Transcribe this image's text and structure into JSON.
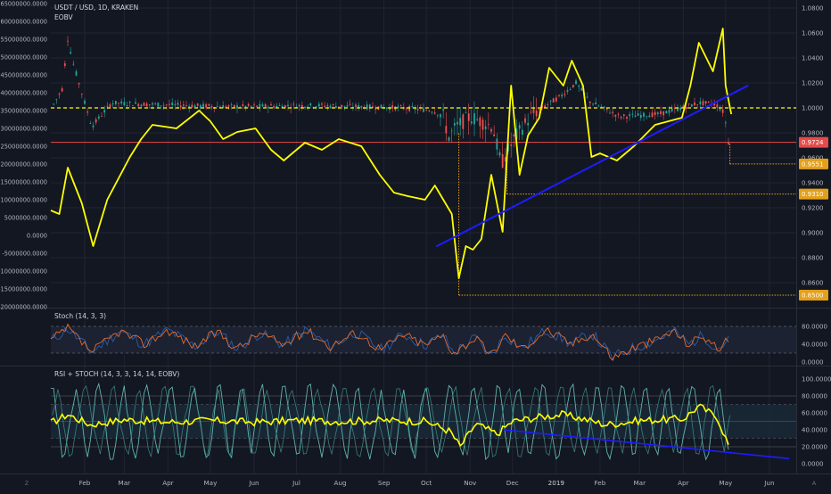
{
  "colors": {
    "background": "#131722",
    "grid": "#1f2433",
    "text": "#b2b5be",
    "eobv_line": "#ffff00",
    "trendline": "#1d1dff",
    "level_line": "#e5a019",
    "current_price_line": "#e64a4a",
    "candle_up": "#26a69a",
    "candle_down": "#ef5350",
    "stoch_k": "#2b5cad",
    "stoch_d": "#e36b2c",
    "rsi_teal": "#5fb3ad"
  },
  "header": {
    "symbol": "USDT / USD, 1D, KRAKEN",
    "indicator": "EOBV"
  },
  "pane_labels": {
    "stoch": "Stoch (14, 3, 3)",
    "rsi_stoch": "RSI + STOCH (14, 3, 3, 14, 14, EOBV)"
  },
  "left_axis_ticks": [
    "65000000.0000",
    "60000000.0000",
    "55000000.0000",
    "50000000.0000",
    "45000000.0000",
    "40000000.0000",
    "35000000.0000",
    "30000000.0000",
    "25000000.0000",
    "20000000.0000",
    "15000000.0000",
    "10000000.0000",
    "5000000.0000",
    "0.0000",
    "-5000000.0000",
    "-10000000.0000",
    "-15000000.0000",
    "-20000000.0000"
  ],
  "right_axis_ticks": [
    "1.0800",
    "1.0600",
    "1.0400",
    "1.0200",
    "1.0000",
    "0.9800",
    "0.9600",
    "0.9400",
    "0.9200",
    "0.9000",
    "0.8800",
    "0.8600"
  ],
  "price_tags": [
    {
      "label": "0.9724",
      "value": 0.9724,
      "type": "current"
    },
    {
      "label": "0.9551",
      "value": 0.9551,
      "type": "level"
    },
    {
      "label": "0.9310",
      "value": 0.931,
      "type": "level"
    },
    {
      "label": "0.8500",
      "value": 0.85,
      "type": "level"
    }
  ],
  "stoch_ticks": [
    "80.0000",
    "40.0000",
    "0.0000"
  ],
  "rsi_ticks": [
    "100.0000",
    "80.0000",
    "60.0000",
    "40.0000",
    "20.0000",
    "0.0000"
  ],
  "time_axis": [
    "Feb",
    "Mar",
    "Apr",
    "May",
    "Jun",
    "Jul",
    "Aug",
    "Sep",
    "Oct",
    "Nov",
    "Dec",
    "2019",
    "Feb",
    "Mar",
    "Apr",
    "May",
    "Jun"
  ],
  "corner_labels": {
    "left": "Z",
    "right": "A"
  },
  "chart_data": {
    "type": "line",
    "title": "USDT / USD, 1D, KRAKEN",
    "x_range": [
      "2018-01-08",
      "2019-06-20"
    ],
    "price_axis_range": [
      0.84,
      1.085
    ],
    "eobv_axis_range": [
      -20000000,
      65000000
    ],
    "series": [
      {
        "name": "EOBV",
        "axis": "left",
        "points": [
          [
            "2018-01-08",
            7000000
          ],
          [
            "2018-01-14",
            6000000
          ],
          [
            "2018-01-20",
            19000000
          ],
          [
            "2018-01-30",
            9000000
          ],
          [
            "2018-02-07",
            -3000000
          ],
          [
            "2018-02-17",
            10000000
          ],
          [
            "2018-03-05",
            22000000
          ],
          [
            "2018-03-13",
            27000000
          ],
          [
            "2018-03-21",
            31000000
          ],
          [
            "2018-04-07",
            30000000
          ],
          [
            "2018-04-23",
            35000000
          ],
          [
            "2018-05-01",
            32000000
          ],
          [
            "2018-05-10",
            27000000
          ],
          [
            "2018-05-20",
            29000000
          ],
          [
            "2018-06-02",
            30000000
          ],
          [
            "2018-06-13",
            24000000
          ],
          [
            "2018-06-22",
            21000000
          ],
          [
            "2018-07-07",
            26000000
          ],
          [
            "2018-07-19",
            24000000
          ],
          [
            "2018-07-31",
            27000000
          ],
          [
            "2018-08-16",
            25000000
          ],
          [
            "2018-08-29",
            17000000
          ],
          [
            "2018-09-08",
            12000000
          ],
          [
            "2018-09-18",
            11000000
          ],
          [
            "2018-09-30",
            10000000
          ],
          [
            "2018-10-07",
            14000000
          ],
          [
            "2018-10-19",
            6000000
          ],
          [
            "2018-10-24",
            -12000000
          ],
          [
            "2018-10-29",
            -3000000
          ],
          [
            "2018-11-03",
            -4000000
          ],
          [
            "2018-11-09",
            -1000000
          ],
          [
            "2018-11-16",
            17000000
          ],
          [
            "2018-11-24",
            1000000
          ],
          [
            "2018-11-30",
            42000000
          ],
          [
            "2018-12-06",
            17000000
          ],
          [
            "2018-12-12",
            28000000
          ],
          [
            "2018-12-20",
            33000000
          ],
          [
            "2018-12-27",
            47000000
          ],
          [
            "2019-01-06",
            42000000
          ],
          [
            "2019-01-12",
            49000000
          ],
          [
            "2019-01-20",
            42000000
          ],
          [
            "2019-01-26",
            22000000
          ],
          [
            "2019-02-01",
            23000000
          ],
          [
            "2019-02-13",
            21000000
          ],
          [
            "2019-02-25",
            25000000
          ],
          [
            "2019-03-12",
            31000000
          ],
          [
            "2019-03-31",
            33000000
          ],
          [
            "2019-04-06",
            42000000
          ],
          [
            "2019-04-12",
            54000000
          ],
          [
            "2019-04-22",
            46000000
          ],
          [
            "2019-04-29",
            58000000
          ],
          [
            "2019-05-01",
            42000000
          ],
          [
            "2019-05-05",
            34000000
          ]
        ]
      },
      {
        "name": "USDT / USD",
        "axis": "right",
        "type": "candles",
        "points": [
          [
            "2018-01-10",
            1.003
          ],
          [
            "2018-01-16",
            1.015
          ],
          [
            "2018-01-20",
            1.055
          ],
          [
            "2018-01-24",
            1.035
          ],
          [
            "2018-01-30",
            1.012
          ],
          [
            "2018-02-06",
            0.985
          ],
          [
            "2018-02-20",
            1.004
          ],
          [
            "2018-03-15",
            1.003
          ],
          [
            "2018-05-15",
            1.001
          ],
          [
            "2018-07-15",
            1.002
          ],
          [
            "2018-09-15",
            1.0
          ],
          [
            "2018-10-05",
            0.998
          ],
          [
            "2018-10-14",
            0.993
          ],
          [
            "2018-10-16",
            0.975
          ],
          [
            "2018-10-22",
            0.985
          ],
          [
            "2018-11-01",
            0.993
          ],
          [
            "2018-11-17",
            0.985
          ],
          [
            "2018-11-23",
            0.955
          ],
          [
            "2018-12-02",
            0.975
          ],
          [
            "2018-12-15",
            0.995
          ],
          [
            "2019-01-05",
            1.01
          ],
          [
            "2019-01-15",
            1.02
          ],
          [
            "2019-01-25",
            1.005
          ],
          [
            "2019-02-15",
            0.993
          ],
          [
            "2019-03-15",
            0.995
          ],
          [
            "2019-04-12",
            1.004
          ],
          [
            "2019-04-24",
            1.003
          ],
          [
            "2019-04-30",
            0.996
          ],
          [
            "2019-05-03",
            0.9724
          ]
        ]
      }
    ],
    "horizontal_lines": [
      {
        "value": 1.0,
        "style": "dashed",
        "color": "#ffff00"
      },
      {
        "value": 0.9724,
        "style": "solid",
        "color": "#e64a4a",
        "label": "0.9724"
      },
      {
        "value": 0.9551,
        "style": "dotted",
        "from": "2019-05-04",
        "label": "0.9551"
      },
      {
        "value": 0.931,
        "style": "dotted",
        "from": "2018-11-27",
        "label": "0.9310"
      },
      {
        "value": 0.85,
        "style": "dotted",
        "from": "2018-10-24",
        "label": "0.8500"
      }
    ],
    "trendlines": [
      {
        "from": [
          "2018-10-08",
          0.889
        ],
        "to": [
          "2019-05-17",
          1.018
        ],
        "axis": "right"
      }
    ],
    "stoch": {
      "ylim": [
        0,
        100
      ],
      "band": [
        20,
        80
      ],
      "k": [
        [
          "2018-01-08",
          48
        ],
        [
          "2018-01-20",
          75
        ],
        [
          "2018-02-06",
          22
        ],
        [
          "2018-02-26",
          70
        ],
        [
          "2018-03-15",
          40
        ],
        [
          "2018-04-01",
          72
        ],
        [
          "2018-04-20",
          35
        ],
        [
          "2018-05-06",
          68
        ],
        [
          "2018-05-20",
          30
        ],
        [
          "2018-06-05",
          65
        ],
        [
          "2018-06-22",
          38
        ],
        [
          "2018-07-08",
          72
        ],
        [
          "2018-07-25",
          35
        ],
        [
          "2018-08-12",
          66
        ],
        [
          "2018-08-30",
          28
        ],
        [
          "2018-09-15",
          62
        ],
        [
          "2018-09-30",
          38
        ],
        [
          "2018-10-13",
          60
        ],
        [
          "2018-10-20",
          20
        ],
        [
          "2018-11-05",
          55
        ],
        [
          "2018-11-15",
          12
        ],
        [
          "2018-11-26",
          60
        ],
        [
          "2018-12-08",
          30
        ],
        [
          "2018-12-25",
          72
        ],
        [
          "2019-01-12",
          40
        ],
        [
          "2019-01-26",
          65
        ],
        [
          "2019-02-10",
          10
        ],
        [
          "2019-02-25",
          32
        ],
        [
          "2019-03-12",
          48
        ],
        [
          "2019-03-25",
          70
        ],
        [
          "2019-04-05",
          40
        ],
        [
          "2019-04-15",
          60
        ],
        [
          "2019-04-25",
          30
        ],
        [
          "2019-05-03",
          48
        ]
      ]
    },
    "rsi_stoch": {
      "ylim": [
        0,
        100
      ],
      "levels": [
        80,
        70,
        50,
        30,
        20
      ],
      "rsi": [
        [
          "2018-01-08",
          48
        ],
        [
          "2018-01-20",
          58
        ],
        [
          "2018-02-05",
          46
        ],
        [
          "2018-03-01",
          52
        ],
        [
          "2018-04-01",
          49
        ],
        [
          "2018-05-01",
          51
        ],
        [
          "2018-06-01",
          49
        ],
        [
          "2018-07-01",
          51
        ],
        [
          "2018-08-01",
          50
        ],
        [
          "2018-09-01",
          51
        ],
        [
          "2018-10-01",
          50
        ],
        [
          "2018-10-18",
          38
        ],
        [
          "2018-10-25",
          20
        ],
        [
          "2018-11-05",
          47
        ],
        [
          "2018-11-20",
          35
        ],
        [
          "2018-12-01",
          50
        ],
        [
          "2018-12-20",
          55
        ],
        [
          "2019-01-05",
          58
        ],
        [
          "2019-01-20",
          53
        ],
        [
          "2019-02-05",
          46
        ],
        [
          "2019-03-01",
          51
        ],
        [
          "2019-04-01",
          53
        ],
        [
          "2019-04-12",
          68
        ],
        [
          "2019-04-25",
          55
        ],
        [
          "2019-05-04",
          18
        ]
      ],
      "trendline": {
        "from": [
          "2018-11-25",
          40
        ],
        "to": [
          "2019-06-15",
          6
        ]
      }
    }
  }
}
